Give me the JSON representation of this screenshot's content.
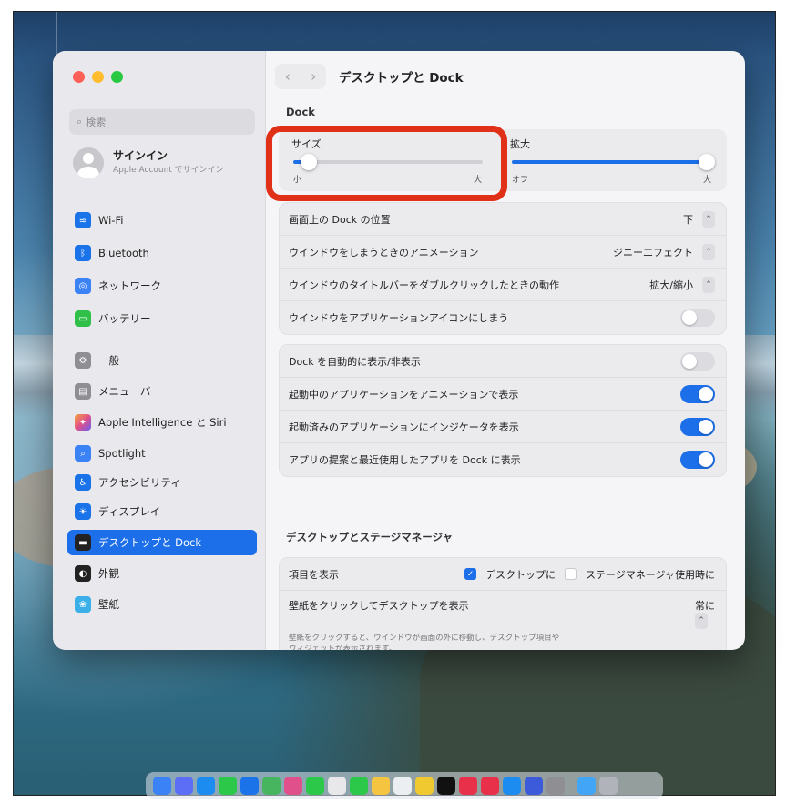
{
  "window": {
    "title": "デスクトップと Dock"
  },
  "sidebar": {
    "search_placeholder": "検索",
    "signin": {
      "name": "サインイン",
      "sub": "Apple Account でサインイン"
    },
    "items": [
      {
        "label": "Wi-Fi",
        "icon": "wifi-icon",
        "color": "#1a73e8"
      },
      {
        "label": "Bluetooth",
        "icon": "bluetooth-icon",
        "color": "#1a73e8"
      },
      {
        "label": "ネットワーク",
        "icon": "globe-icon",
        "color": "#3b82f6"
      },
      {
        "label": "バッテリー",
        "icon": "battery-icon",
        "color": "#30c04a"
      },
      {
        "label": "一般",
        "icon": "gear-icon",
        "color": "#8e8e93"
      },
      {
        "label": "メニューバー",
        "icon": "menubar-icon",
        "color": "#8e8e93"
      },
      {
        "label": "Apple Intelligence と Siri",
        "icon": "siri-icon",
        "color": "#e0508a"
      },
      {
        "label": "Spotlight",
        "icon": "spotlight-icon",
        "color": "#3b82f6"
      },
      {
        "label": "アクセシビリティ",
        "icon": "accessibility-icon",
        "color": "#1a73e8"
      },
      {
        "label": "ディスプレイ",
        "icon": "display-icon",
        "color": "#1a73e8"
      },
      {
        "label": "デスクトップと Dock",
        "icon": "dock-icon",
        "color": "#222222",
        "active": true
      },
      {
        "label": "外観",
        "icon": "appearance-icon",
        "color": "#222222"
      },
      {
        "label": "壁紙",
        "icon": "wallpaper-icon",
        "color": "#3bb0e8"
      }
    ]
  },
  "dock_section": {
    "header": "Dock",
    "size": {
      "label": "サイズ",
      "min": "小",
      "max": "大",
      "level": 0.08
    },
    "magnify": {
      "label": "拡大",
      "min": "オフ",
      "max": "大",
      "level": 0.98
    },
    "rows": [
      {
        "label": "画面上の Dock の位置",
        "value": "下",
        "control": "select"
      },
      {
        "label": "ウインドウをしまうときのアニメーション",
        "value": "ジニーエフェクト",
        "control": "select"
      },
      {
        "label": "ウインドウのタイトルバーをダブルクリックしたときの動作",
        "value": "拡大/縮小",
        "control": "select"
      },
      {
        "label": "ウインドウをアプリケーションアイコンにしまう",
        "control": "toggle",
        "on": false
      }
    ],
    "rows2": [
      {
        "label": "Dock を自動的に表示/非表示",
        "control": "toggle",
        "on": false
      },
      {
        "label": "起動中のアプリケーションをアニメーションで表示",
        "control": "toggle",
        "on": true
      },
      {
        "label": "起動済みのアプリケーションにインジケータを表示",
        "control": "toggle",
        "on": true
      },
      {
        "label": "アプリの提案と最近使用したアプリを Dock に表示",
        "control": "toggle",
        "on": true
      }
    ]
  },
  "stage_section": {
    "header": "デスクトップとステージマネージャ",
    "show_items": {
      "label": "項目を表示",
      "opt1": "デスクトップに",
      "opt2": "ステージマネージャ使用時に"
    },
    "click_wallpaper": {
      "label": "壁紙をクリックしてデスクトップを表示",
      "value": "常に",
      "note": "壁紙をクリックすると、ウインドウが画面の外に移動し、デスクトップ項目やウィジェットが表示されます。"
    }
  }
}
